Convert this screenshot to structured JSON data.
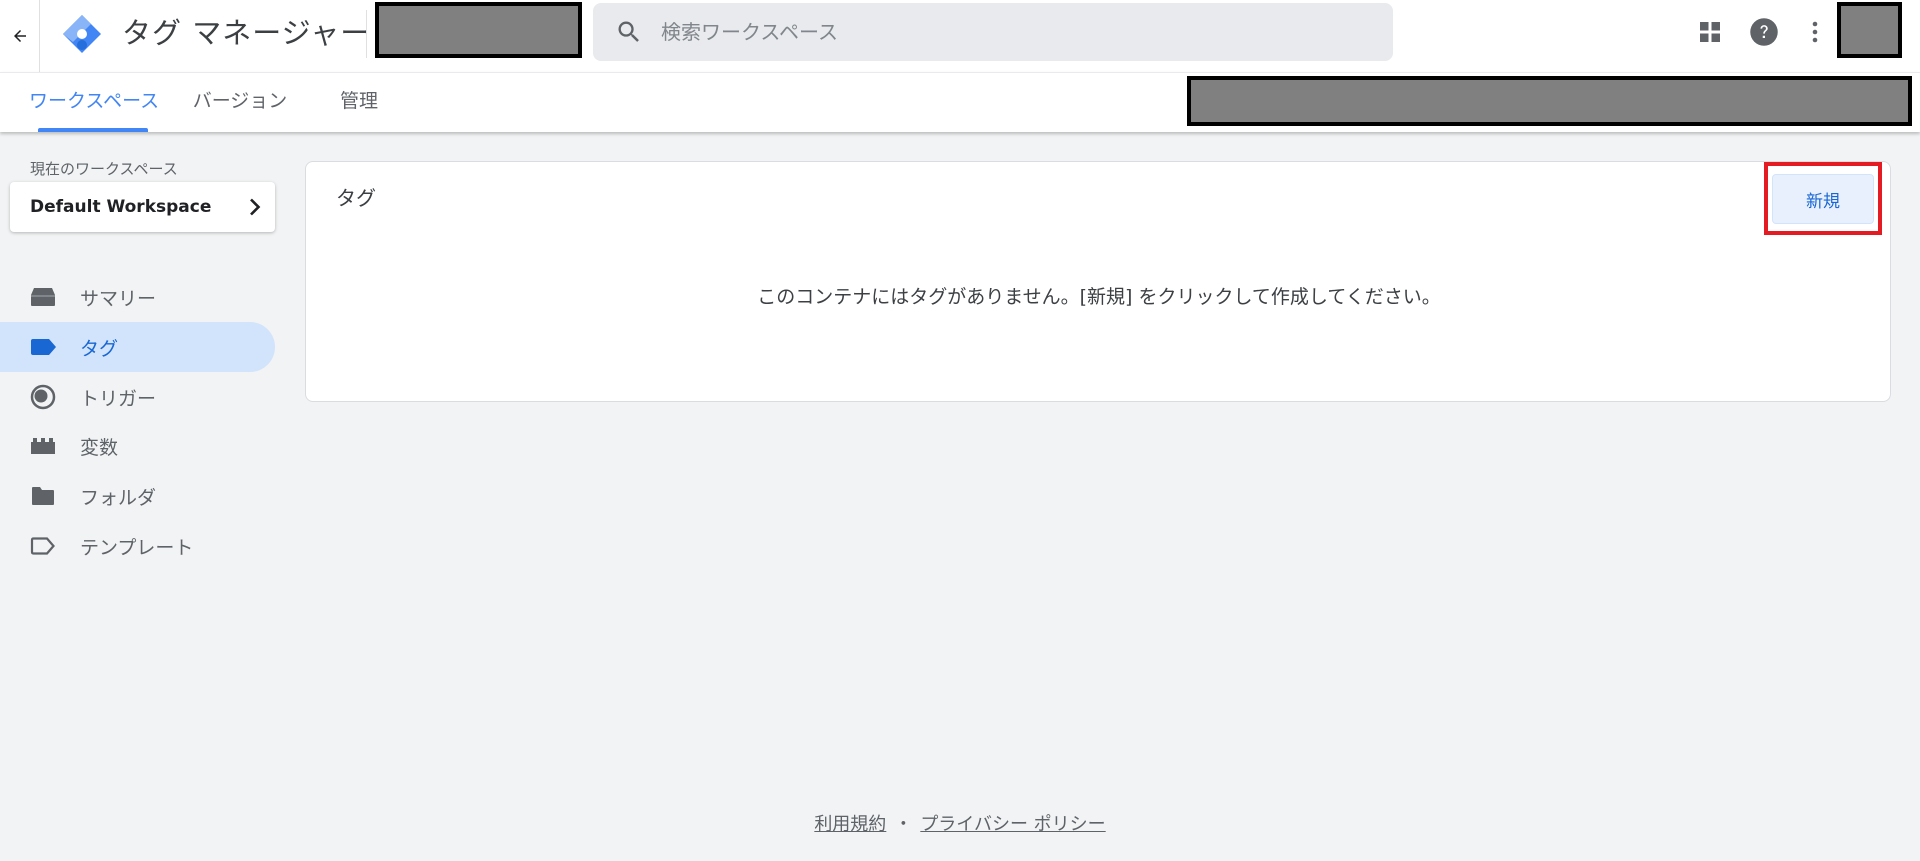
{
  "app": {
    "title": "タグ マネージャー",
    "brand_color": "#4285f4"
  },
  "header": {
    "search": {
      "placeholder": "検索ワークスペース",
      "value": ""
    },
    "icons": [
      "back-arrow-icon",
      "tag-manager-logo-icon",
      "search-icon",
      "apps-grid-icon",
      "help-icon",
      "more-vert-icon"
    ]
  },
  "tabs": [
    {
      "label": "ワークスペース",
      "active": true
    },
    {
      "label": "バージョン",
      "active": false
    },
    {
      "label": "管理",
      "active": false
    }
  ],
  "sidebar": {
    "workspace_label": "現在のワークスペース",
    "workspace_name": "Default Workspace",
    "items": [
      {
        "label": "サマリー",
        "icon": "summary-icon",
        "active": false
      },
      {
        "label": "タグ",
        "icon": "tag-icon",
        "active": true
      },
      {
        "label": "トリガー",
        "icon": "trigger-icon",
        "active": false
      },
      {
        "label": "変数",
        "icon": "variables-icon",
        "active": false
      },
      {
        "label": "フォルダ",
        "icon": "folder-icon",
        "active": false
      },
      {
        "label": "テンプレート",
        "icon": "template-icon",
        "active": false
      }
    ],
    "active_color": "#d2e3fc"
  },
  "main": {
    "card_title": "タグ",
    "new_button": "新規",
    "empty_message": "このコンテナにはタグがありません。[新規] をクリックして作成してください。",
    "highlight_color": "#e41b23"
  },
  "footer": {
    "terms": "利用規約",
    "separator": "・",
    "privacy": "プライバシー ポリシー"
  }
}
